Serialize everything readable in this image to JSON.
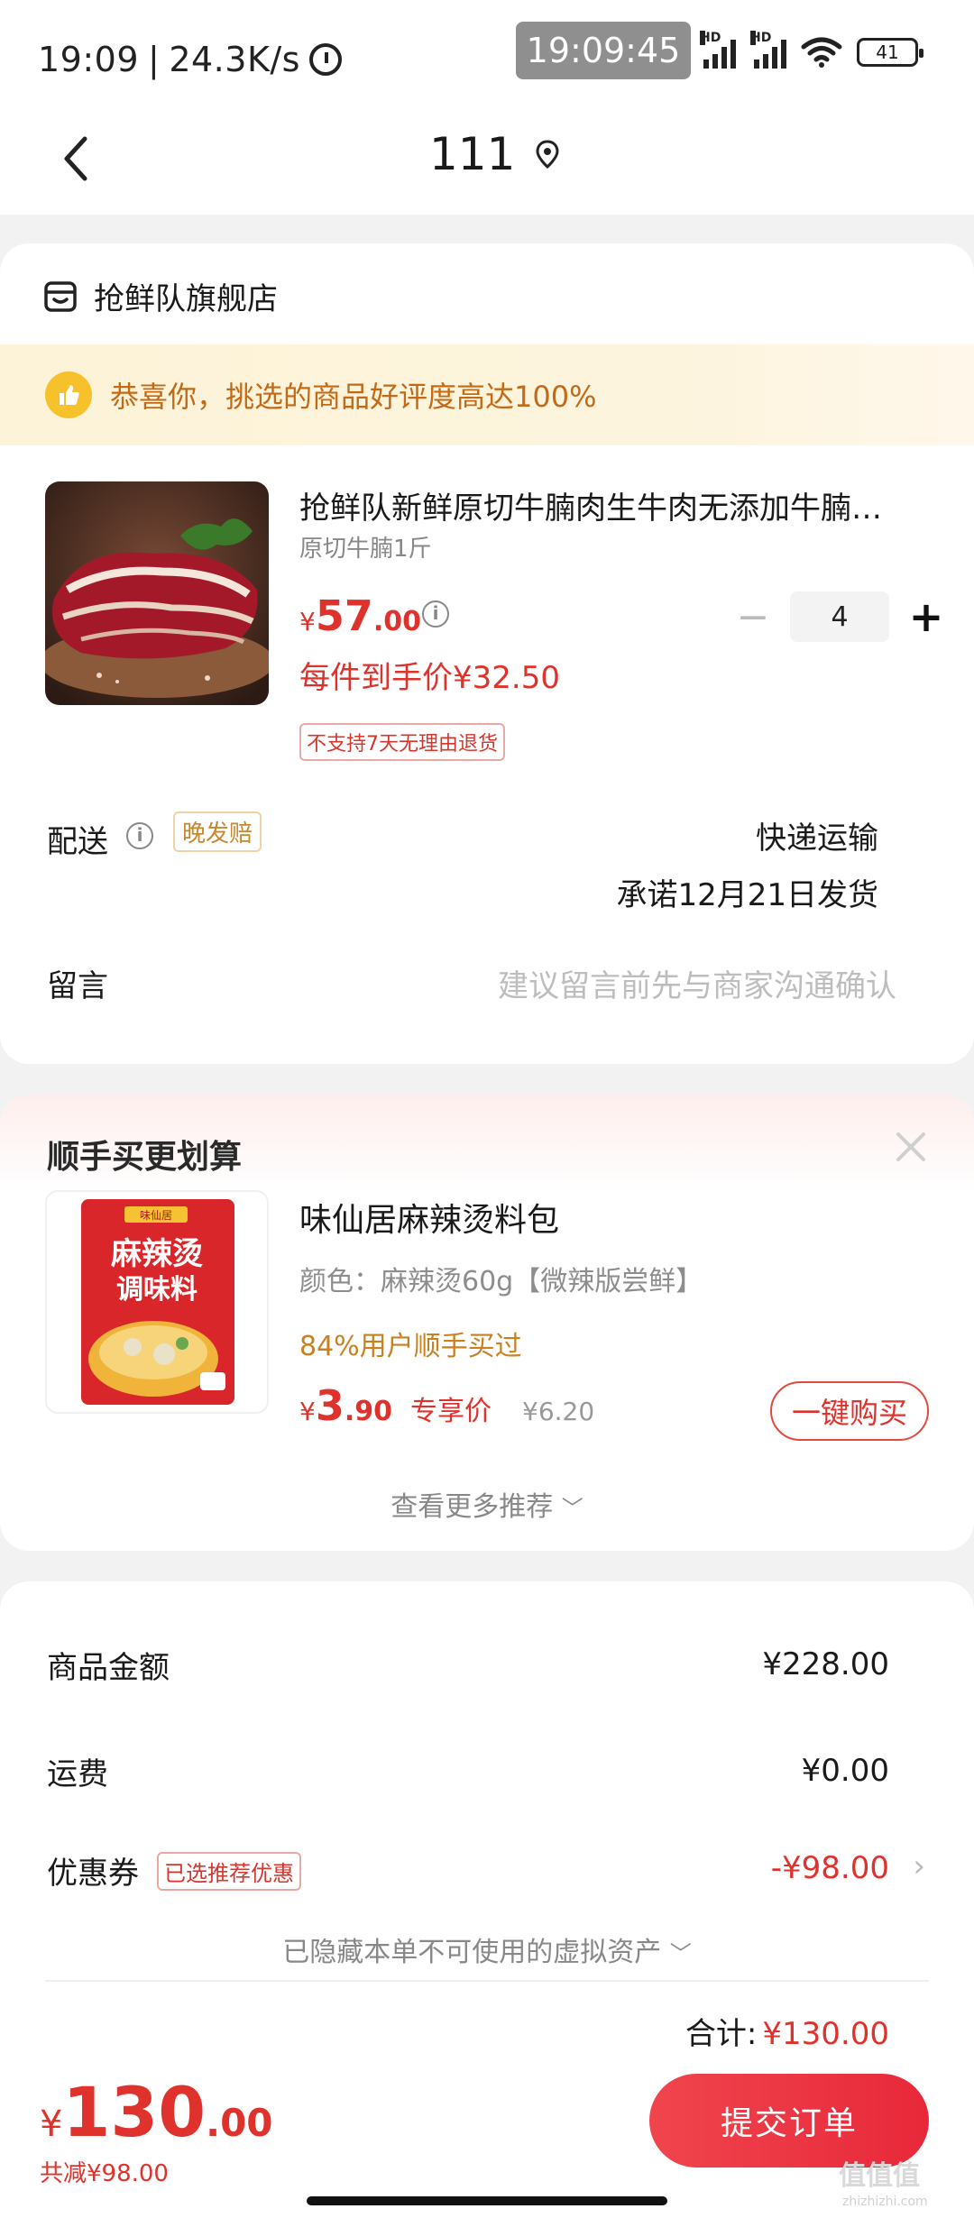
{
  "status_bar": {
    "time": "19:09",
    "speed": "24.3K/s",
    "time_badge": "19:09:45",
    "battery": "41",
    "hd1": "HD",
    "hd2": "HD"
  },
  "header": {
    "title": "111"
  },
  "store": {
    "name": "抢鲜队旗舰店"
  },
  "praise_banner": {
    "text": "恭喜你，挑选的商品好评度高达100%"
  },
  "product": {
    "title": "抢鲜队新鲜原切牛腩肉生牛肉无添加牛腩…",
    "spec": "原切牛腩1斤",
    "price_currency": "¥",
    "price_int": "57",
    "price_dec": ".00",
    "quantity": "4",
    "unit_price": "每件到手价¥32.50",
    "return_tag": "不支持7天无理由退货"
  },
  "delivery": {
    "label": "配送",
    "late_tag": "晚发赔",
    "method": "快递运输",
    "promise": "承诺12月21日发货"
  },
  "message": {
    "label": "留言",
    "placeholder": "建议留言前先与商家沟通确认"
  },
  "recommend": {
    "title": "顺手买更划算",
    "item_name": "味仙居麻辣烫料包",
    "item_color": "颜色：麻辣烫60g【微辣版尝鲜】",
    "item_bought": "84%用户顺手买过",
    "price_currency": "¥",
    "price_int": "3",
    "price_dec": ".90",
    "price_exclusive": "专享价",
    "price_original": "¥6.20",
    "buy_label": "一键购买",
    "see_more": "查看更多推荐",
    "pack_top": "味仙居",
    "pack_line1": "麻辣烫",
    "pack_line2": "调味料"
  },
  "summary": {
    "goods_label": "商品金额",
    "goods_value": "¥228.00",
    "shipping_label": "运费",
    "shipping_value": "¥0.00",
    "coupon_label": "优惠券",
    "coupon_tag": "已选推荐优惠",
    "coupon_value": "-¥98.00",
    "hidden_assets": "已隐藏本单不可使用的虚拟资产",
    "total_label": "合计:",
    "total_value": "¥130.00"
  },
  "bottom_bar": {
    "price_currency": "¥",
    "price_int": "130",
    "price_dec": ".00",
    "saved": "共减¥98.00",
    "submit_label": "提交订单"
  },
  "watermark": {
    "text": "值值值",
    "sub": "zhizhizhi.com"
  },
  "colors": {
    "accent_red": "#e0322c",
    "banner_text": "#c46a17",
    "gold": "#c9811f"
  }
}
